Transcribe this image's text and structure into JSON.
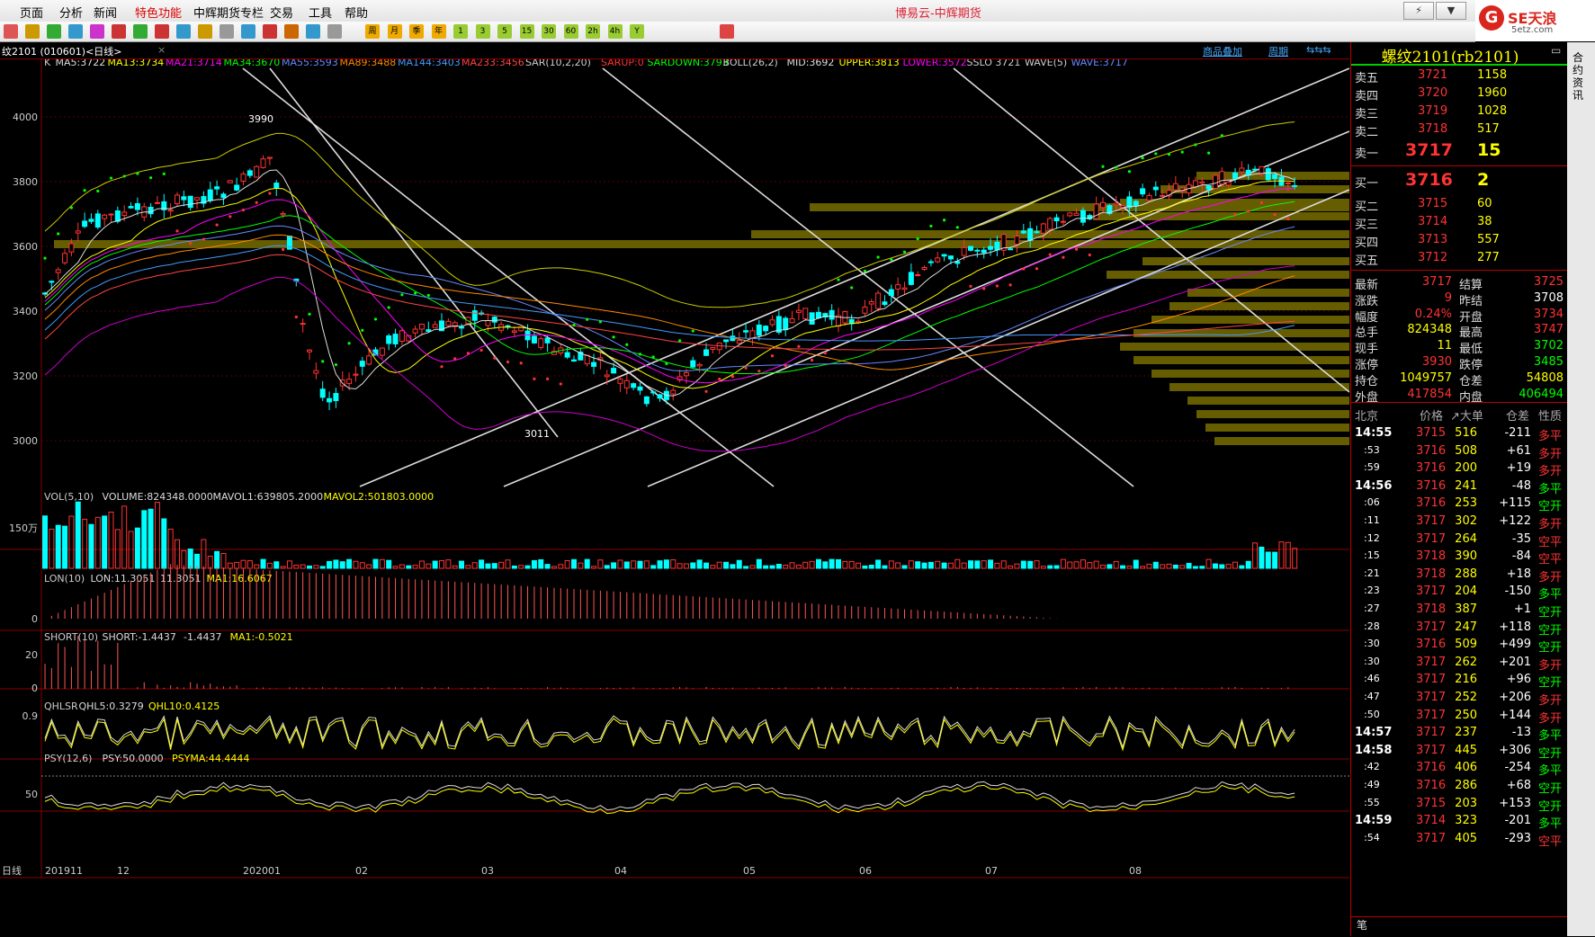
{
  "menu": [
    "页面",
    "分析",
    "新闻",
    "特色功能",
    "中辉期货专栏",
    "交易",
    "工具",
    "帮助"
  ],
  "window_title": "博易云-中辉期货",
  "brand": {
    "logo": "G",
    "name": "SE天浪",
    "url": "5etz.com"
  },
  "toolbar_texts": [
    "周",
    "月",
    "季",
    "年",
    "1",
    "3",
    "5",
    "15",
    "30",
    "60",
    "2h",
    "4h",
    "Y"
  ],
  "tab": {
    "code": "纹2101 (010601)<日线>",
    "overlay_link": "商品叠加",
    "period_link": "周期"
  },
  "indicators": {
    "main": [
      {
        "t": "K",
        "c": "#ccc"
      },
      {
        "t": "MA5:3722",
        "c": "#ddd"
      },
      {
        "t": "MA13:3734",
        "c": "#ff0"
      },
      {
        "t": "MA21:3714",
        "c": "#f0f"
      },
      {
        "t": "MA34:3670",
        "c": "#0f0"
      },
      {
        "t": "MA55:3593",
        "c": "#68f"
      },
      {
        "t": "MA89:3488",
        "c": "#f80"
      },
      {
        "t": "MA144:3403",
        "c": "#49f"
      },
      {
        "t": "MA233:3456",
        "c": "#f44"
      },
      {
        "t": "SAR(10,2,20)",
        "c": "#ccc"
      },
      {
        "t": "SARUP:0",
        "c": "#f33"
      },
      {
        "t": "SARDOWN:3793",
        "c": "#0f0"
      },
      {
        "t": "BOLL(26,2)",
        "c": "#ccc"
      },
      {
        "t": "MID:3692",
        "c": "#ddd"
      },
      {
        "t": "UPPER:3813",
        "c": "#ff0"
      },
      {
        "t": "LOWER:3572",
        "c": "#f0f"
      },
      {
        "t": "SSLO 3721",
        "c": "#ccc"
      },
      {
        "t": "WAVE(5)",
        "c": "#ccc"
      },
      {
        "t": "WAVE:3717",
        "c": "#68f"
      }
    ],
    "vol": [
      {
        "t": "VOL(5,10)",
        "c": "#ccc"
      },
      {
        "t": "VOLUME:824348.0000",
        "c": "#ddd"
      },
      {
        "t": "MAVOL1:639805.2000",
        "c": "#ddd"
      },
      {
        "t": "MAVOL2:501803.0000",
        "c": "#ff0"
      }
    ],
    "lon": [
      {
        "t": "LON(10)",
        "c": "#ccc"
      },
      {
        "t": "LON:11.3051",
        "c": "#ddd"
      },
      {
        "t": "11.3051",
        "c": "#ddd"
      },
      {
        "t": "MA1:16.6067",
        "c": "#ff0"
      }
    ],
    "short": [
      {
        "t": "SHORT(10)",
        "c": "#ccc"
      },
      {
        "t": "SHORT:-1.4437",
        "c": "#ddd"
      },
      {
        "t": "-1.4437",
        "c": "#ddd"
      },
      {
        "t": "MA1:-0.5021",
        "c": "#ff0"
      }
    ],
    "qhl": [
      {
        "t": "QHLSR",
        "c": "#ccc"
      },
      {
        "t": "QHL5:0.3279",
        "c": "#ddd"
      },
      {
        "t": "QHL10:0.4125",
        "c": "#ff0"
      }
    ],
    "psy": [
      {
        "t": "PSY(12,6)",
        "c": "#ccc"
      },
      {
        "t": "PSY:50.0000",
        "c": "#ddd"
      },
      {
        "t": "PSYMA:44.4444",
        "c": "#ff0"
      }
    ]
  },
  "y_axis": {
    "main": [
      "4000",
      "3800",
      "3600",
      "3400",
      "3200",
      "3000"
    ],
    "vol": "150万",
    "lon": "0",
    "short": [
      "20",
      "0"
    ],
    "qhl": "0.9",
    "psy": "50"
  },
  "annotations": {
    "high": "3990",
    "low": "3011"
  },
  "x_axis": [
    "日线",
    "201911",
    "12",
    "202001",
    "02",
    "03",
    "04",
    "05",
    "06",
    "07",
    "08"
  ],
  "quote": {
    "title": "螺纹2101(rb2101)",
    "asks": [
      {
        "label": "卖五",
        "price": "3721",
        "vol": "1158"
      },
      {
        "label": "卖四",
        "price": "3720",
        "vol": "1960"
      },
      {
        "label": "卖三",
        "price": "3719",
        "vol": "1028"
      },
      {
        "label": "卖二",
        "price": "3718",
        "vol": "517"
      },
      {
        "label": "卖一",
        "price": "3717",
        "vol": "15"
      }
    ],
    "bids": [
      {
        "label": "买一",
        "price": "3716",
        "vol": "2"
      },
      {
        "label": "买二",
        "price": "3715",
        "vol": "60"
      },
      {
        "label": "买三",
        "price": "3714",
        "vol": "38"
      },
      {
        "label": "买四",
        "price": "3713",
        "vol": "557"
      },
      {
        "label": "买五",
        "price": "3712",
        "vol": "277"
      }
    ],
    "stats": [
      {
        "l1": "最新",
        "v1": "3717",
        "c1": "#f33",
        "l2": "结算",
        "v2": "3725",
        "c2": "#f33"
      },
      {
        "l1": "涨跌",
        "v1": "9",
        "c1": "#f33",
        "l2": "昨结",
        "v2": "3708",
        "c2": "#fff"
      },
      {
        "l1": "幅度",
        "v1": "0.24%",
        "c1": "#f33",
        "l2": "开盘",
        "v2": "3734",
        "c2": "#f33"
      },
      {
        "l1": "总手",
        "v1": "824348",
        "c1": "#ff0",
        "l2": "最高",
        "v2": "3747",
        "c2": "#f33"
      },
      {
        "l1": "现手",
        "v1": "11",
        "c1": "#ff0",
        "l2": "最低",
        "v2": "3702",
        "c2": "#0f0"
      },
      {
        "l1": "涨停",
        "v1": "3930",
        "c1": "#f33",
        "l2": "跌停",
        "v2": "3485",
        "c2": "#0f0"
      },
      {
        "l1": "持仓",
        "v1": "1049757",
        "c1": "#ff0",
        "l2": "仓差",
        "v2": "54808",
        "c2": "#ff0"
      },
      {
        "l1": "外盘",
        "v1": "417854",
        "c1": "#f33",
        "l2": "内盘",
        "v2": "406494",
        "c2": "#0f0"
      }
    ],
    "ticks_header": [
      "北京",
      "价格",
      "↗大单",
      "仓差",
      "性质"
    ],
    "ticks": [
      {
        "t": "14:55",
        "p": "3715",
        "v": "516",
        "d": "-211",
        "n": "多平",
        "pc": "#f33",
        "nc": "#f33"
      },
      {
        "t": ":53",
        "p": "3716",
        "v": "508",
        "d": "+61",
        "n": "多开",
        "pc": "#f33",
        "nc": "#f33"
      },
      {
        "t": ":59",
        "p": "3716",
        "v": "200",
        "d": "+19",
        "n": "多开",
        "pc": "#f33",
        "nc": "#f33"
      },
      {
        "t": "14:56",
        "p": "3716",
        "v": "241",
        "d": "-48",
        "n": "多平",
        "pc": "#f33",
        "nc": "#0f0"
      },
      {
        "t": ":06",
        "p": "3716",
        "v": "253",
        "d": "+115",
        "n": "空开",
        "pc": "#f33",
        "nc": "#0f0"
      },
      {
        "t": ":11",
        "p": "3717",
        "v": "302",
        "d": "+122",
        "n": "多开",
        "pc": "#f33",
        "nc": "#f33"
      },
      {
        "t": ":12",
        "p": "3717",
        "v": "264",
        "d": "-35",
        "n": "空平",
        "pc": "#f33",
        "nc": "#f33"
      },
      {
        "t": ":15",
        "p": "3718",
        "v": "390",
        "d": "-84",
        "n": "空平",
        "pc": "#f33",
        "nc": "#f33"
      },
      {
        "t": ":21",
        "p": "3718",
        "v": "288",
        "d": "+18",
        "n": "多开",
        "pc": "#f33",
        "nc": "#f33"
      },
      {
        "t": ":23",
        "p": "3717",
        "v": "204",
        "d": "-150",
        "n": "多平",
        "pc": "#f33",
        "nc": "#0f0"
      },
      {
        "t": ":27",
        "p": "3718",
        "v": "387",
        "d": "+1",
        "n": "空开",
        "pc": "#f33",
        "nc": "#0f0"
      },
      {
        "t": ":28",
        "p": "3717",
        "v": "247",
        "d": "+118",
        "n": "空开",
        "pc": "#f33",
        "nc": "#0f0"
      },
      {
        "t": ":30",
        "p": "3716",
        "v": "509",
        "d": "+499",
        "n": "空开",
        "pc": "#f33",
        "nc": "#0f0"
      },
      {
        "t": ":30",
        "p": "3717",
        "v": "262",
        "d": "+201",
        "n": "多开",
        "pc": "#f33",
        "nc": "#f33"
      },
      {
        "t": ":46",
        "p": "3717",
        "v": "216",
        "d": "+96",
        "n": "空开",
        "pc": "#f33",
        "nc": "#0f0"
      },
      {
        "t": ":47",
        "p": "3717",
        "v": "252",
        "d": "+206",
        "n": "多开",
        "pc": "#f33",
        "nc": "#f33"
      },
      {
        "t": ":50",
        "p": "3717",
        "v": "250",
        "d": "+144",
        "n": "多开",
        "pc": "#f33",
        "nc": "#f33"
      },
      {
        "t": "14:57",
        "p": "3717",
        "v": "237",
        "d": "-13",
        "n": "多平",
        "pc": "#f33",
        "nc": "#0f0"
      },
      {
        "t": "14:58",
        "p": "3717",
        "v": "445",
        "d": "+306",
        "n": "空开",
        "pc": "#f33",
        "nc": "#0f0"
      },
      {
        "t": ":42",
        "p": "3716",
        "v": "406",
        "d": "-254",
        "n": "多平",
        "pc": "#f33",
        "nc": "#0f0"
      },
      {
        "t": ":49",
        "p": "3716",
        "v": "286",
        "d": "+68",
        "n": "空开",
        "pc": "#f33",
        "nc": "#0f0"
      },
      {
        "t": ":55",
        "p": "3715",
        "v": "203",
        "d": "+153",
        "n": "空开",
        "pc": "#f33",
        "nc": "#0f0"
      },
      {
        "t": "14:59",
        "p": "3714",
        "v": "323",
        "d": "-201",
        "n": "多平",
        "pc": "#f33",
        "nc": "#0f0"
      },
      {
        "t": ":54",
        "p": "3717",
        "v": "405",
        "d": "-293",
        "n": "空平",
        "pc": "#f33",
        "nc": "#f33"
      }
    ],
    "footer_label": "笔"
  },
  "side_tab": "合约资讯",
  "colors": {
    "up": "#ff3333",
    "down": "#00ffff",
    "grid": "#800000",
    "accent": "#ffcc00"
  }
}
